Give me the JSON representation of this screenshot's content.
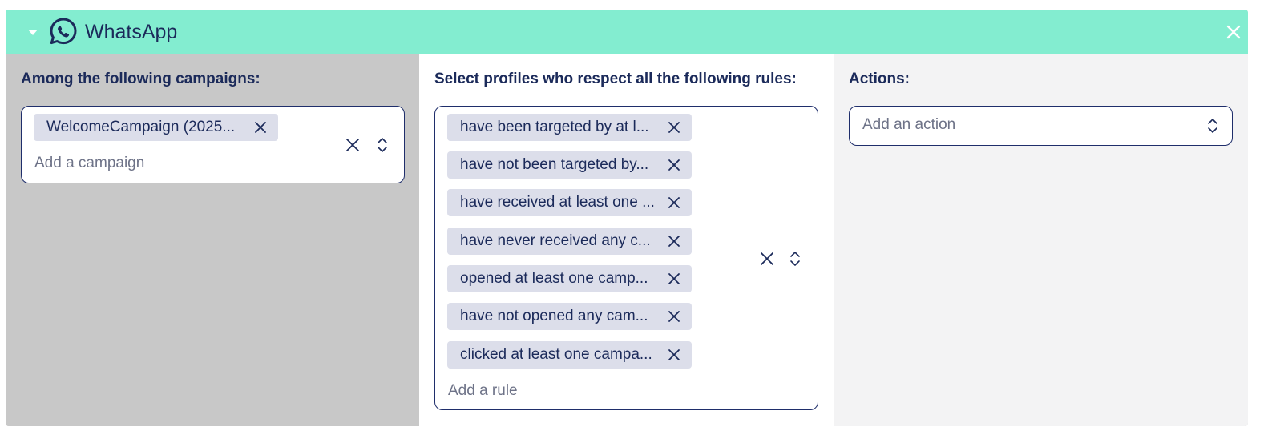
{
  "header": {
    "title": "WhatsApp",
    "accent": "#83edd0"
  },
  "campaigns": {
    "label": "Among the following campaigns:",
    "chips": [
      "WelcomeCampaign (2025..."
    ],
    "placeholder": "Add a campaign"
  },
  "rules": {
    "label": "Select profiles who respect all the following rules:",
    "chips": [
      "have been targeted by at l...",
      "have not been targeted by...",
      "have received at least one ...",
      "have never received any c...",
      "opened at least one camp...",
      "have not opened any cam...",
      "clicked at least one campa..."
    ],
    "placeholder": "Add a rule"
  },
  "actions": {
    "label": "Actions:",
    "placeholder": "Add an action"
  }
}
